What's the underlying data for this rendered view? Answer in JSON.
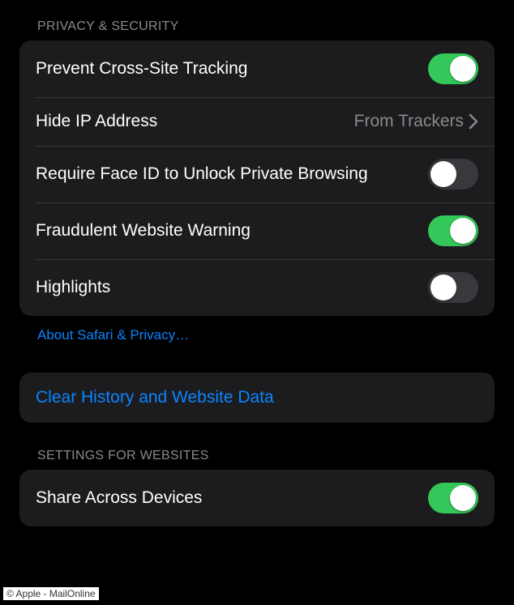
{
  "sections": {
    "privacy": {
      "header": "Privacy & Security",
      "rows": {
        "prevent_tracking": {
          "label": "Prevent Cross-Site Tracking",
          "on": true
        },
        "hide_ip": {
          "label": "Hide IP Address",
          "value": "From Trackers"
        },
        "require_faceid": {
          "label": "Require Face ID to Unlock Private Browsing",
          "on": false
        },
        "fraud_warning": {
          "label": "Fraudulent Website Warning",
          "on": true
        },
        "highlights": {
          "label": "Highlights",
          "on": false
        }
      },
      "footer_link": "About Safari & Privacy…"
    },
    "clear": {
      "label": "Clear History and Website Data"
    },
    "websites": {
      "header": "Settings for Websites",
      "rows": {
        "share_devices": {
          "label": "Share Across Devices",
          "on": true
        }
      }
    }
  },
  "credit": "© Apple - MailOnline",
  "colors": {
    "accent_green": "#34c759",
    "link_blue": "#0a84ff",
    "card_bg": "#1c1c1e",
    "secondary_text": "#8a8a8e"
  }
}
